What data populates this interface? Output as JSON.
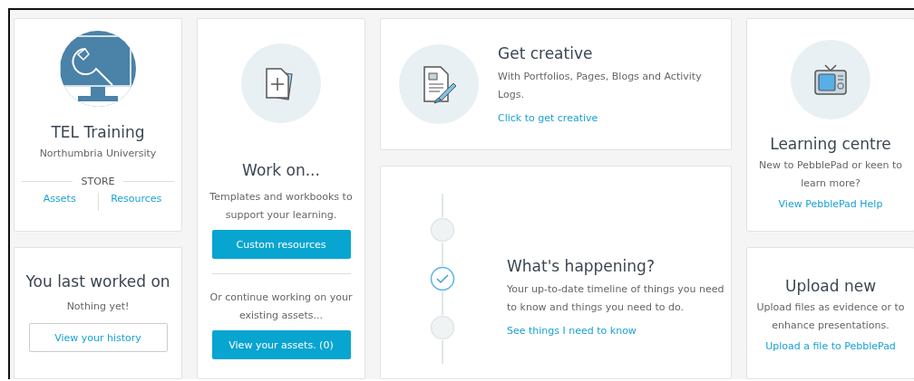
{
  "profile": {
    "name": "TEL Training",
    "organisation": "Northumbria University",
    "store_label": "STORE",
    "links": [
      "Assets",
      "Resources"
    ]
  },
  "last_worked": {
    "title": "You last worked on",
    "text": "Nothing yet!",
    "button": "View your history"
  },
  "work_on": {
    "title": "Work on...",
    "text": "Templates and workbooks to support your learning.",
    "button": "Custom resources",
    "text_2": "Or continue working on your existing assets...",
    "button_2": "View your assets. (0)"
  },
  "get_creative": {
    "title": "Get creative",
    "text": "With Portfolios, Pages, Blogs and Activity Logs.",
    "link": "Click to get creative"
  },
  "whats_happening": {
    "title": "What's happening?",
    "text": "Your up-to-date timeline of things you need to know and things you need to do.",
    "link": "See things I need to know",
    "timeline": [
      {
        "checked": false
      },
      {
        "checked": true
      },
      {
        "checked": false
      }
    ]
  },
  "learning_centre": {
    "title": "Learning centre",
    "text": "New to PebblePad or keen to learn more?",
    "link": "View PebblePad Help"
  },
  "upload_new": {
    "title": "Upload new",
    "text": "Upload files as evidence or to enhance presentations.",
    "link": "Upload a file to PebblePad"
  }
}
